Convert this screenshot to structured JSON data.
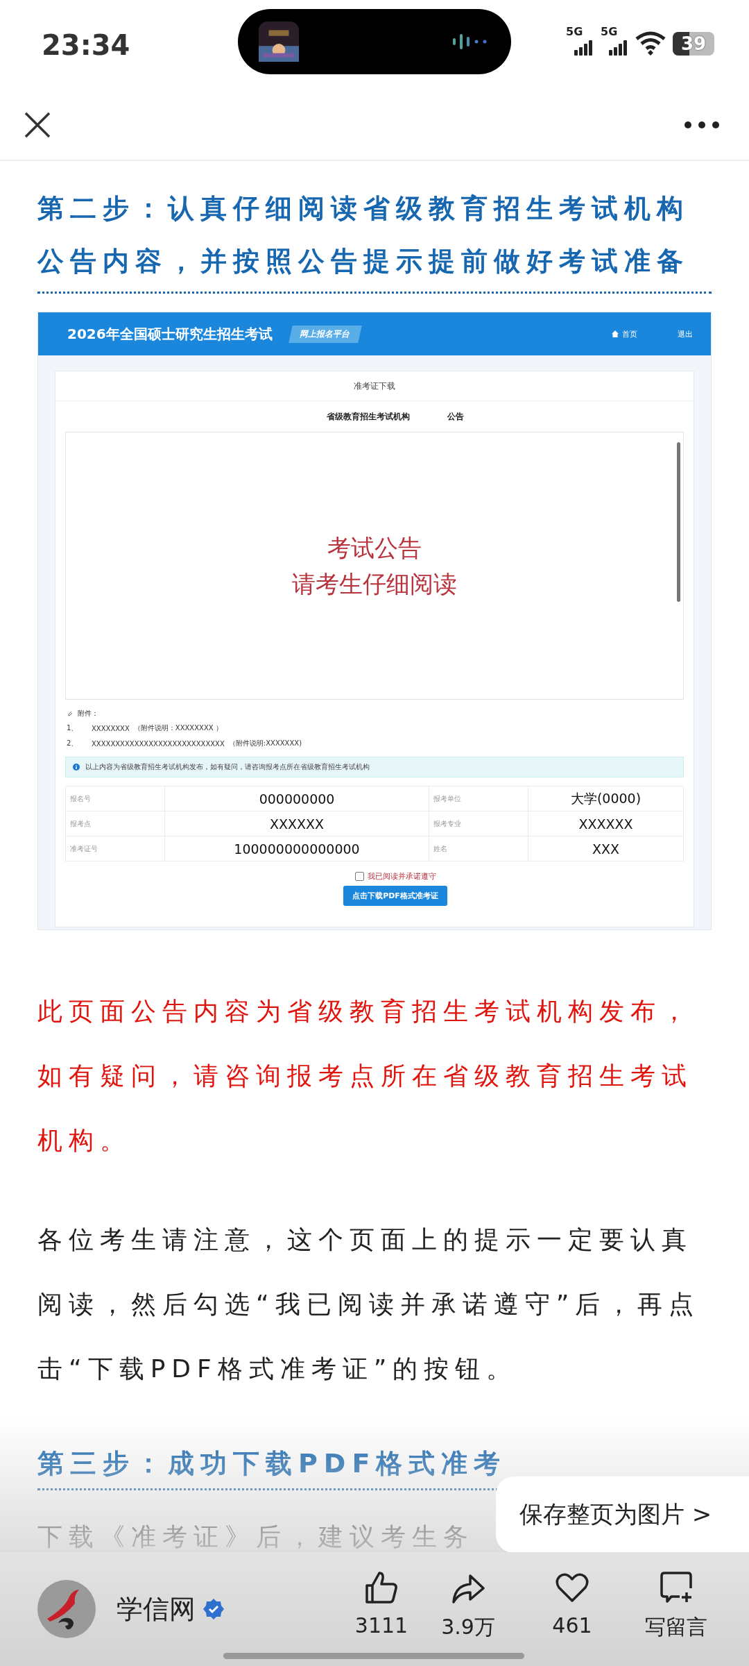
{
  "status_bar": {
    "time": "23:34",
    "signal_1": "5G",
    "signal_2": "5G",
    "battery": "39"
  },
  "step2_heading": "第二步：认真仔细阅读省级教育招生考试机构公告内容，并按照公告提示提前做好考试准备",
  "screenshot": {
    "site_title": "2026年全国硕士研究生招生考试",
    "platform_tag": "网上报名平台",
    "nav_links": [
      "首页",
      "退出"
    ],
    "card_title": "准考证下载",
    "subtitle_org": "省级教育招生考试机构",
    "subtitle_notice": "公告",
    "notice_lines": [
      "考试公告",
      "请考生仔细阅读"
    ],
    "attachments_label": "附件：",
    "attachments": [
      {
        "index": "1、",
        "name": "XXXXXXXX",
        "note": "（附件说明：XXXXXXXX ）"
      },
      {
        "index": "2、",
        "name": "XXXXXXXXXXXXXXXXXXXXXXXXXXXX",
        "note": "（附件说明:XXXXXXX)"
      }
    ],
    "info_banner": "以上内容为省级教育招生考试机构发布，如有疑问，请咨询报考点所在省级教育招生考试机构",
    "table": [
      [
        "报名号",
        "000000000",
        "报考单位",
        "大学(0000)"
      ],
      [
        "报考点",
        "XXXXXX",
        "报考专业",
        "XXXXXX"
      ],
      [
        "准考证号",
        "100000000000000",
        "姓名",
        "XXX"
      ]
    ],
    "agree": {
      "label": "我已阅读并承诺遵守",
      "checked": false
    },
    "download_button": "点击下载PDF格式准考证"
  },
  "red_notice": "此页面公告内容为省级教育招生考试机构发布，如有疑问，请咨询报考点所在省级教育招生考试机构。",
  "paragraph": "各位考生请注意，这个页面上的提示一定要认真阅读，然后勾选“我已阅读并承诺遵守”后，再点击“下载PDF格式准考证”的按钮。",
  "step3_heading": "第三步：成功下载PDF格式准考",
  "paragraph_cut": "下载《准考证》后，建议考生务",
  "save_popup": "保存整页为图片 >",
  "author": {
    "name": "学信网",
    "verified": true
  },
  "actions": [
    {
      "kind": "like",
      "count": "3111"
    },
    {
      "kind": "share",
      "count": "3.9万"
    },
    {
      "kind": "favorite",
      "count": "461"
    },
    {
      "kind": "comment",
      "count": "写留言"
    }
  ]
}
